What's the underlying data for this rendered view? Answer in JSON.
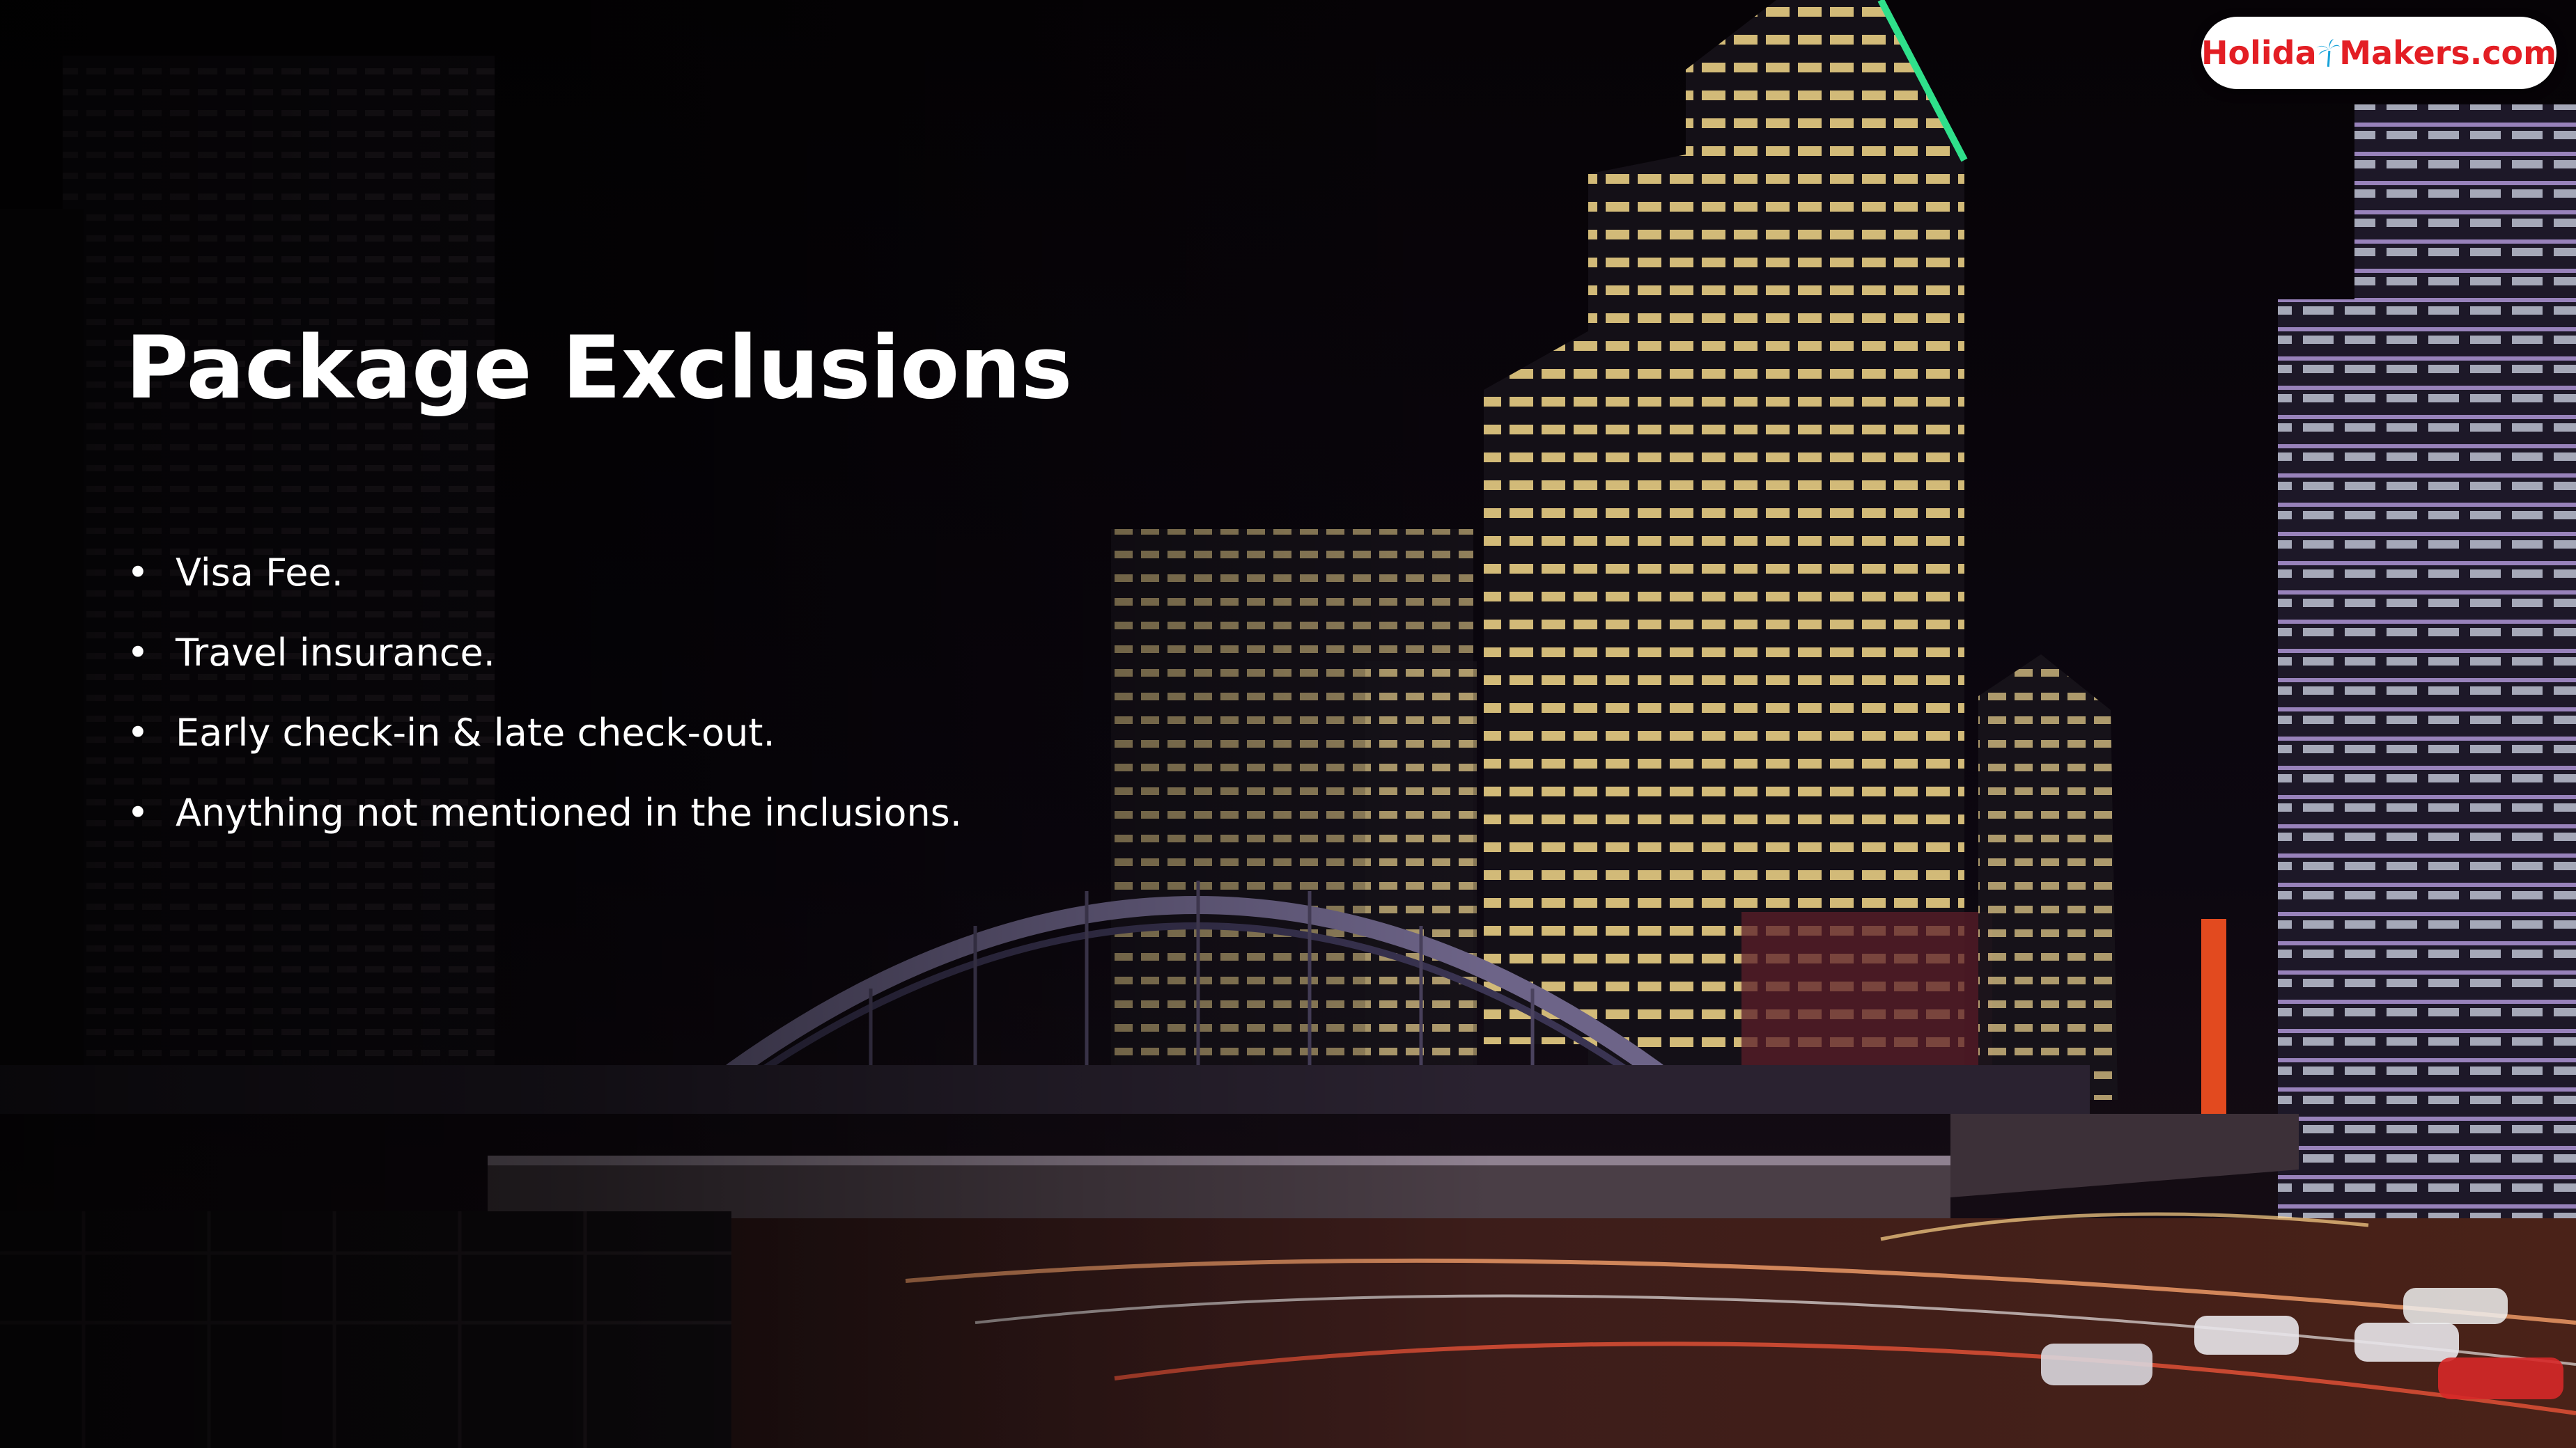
{
  "slide": {
    "title": "Package Exclusions",
    "bullet_glyph": "•",
    "bullets": [
      "Visa Fee.",
      "Travel insurance.",
      "Early check-in & late check-out.",
      "Anything not mentioned in the inclusions."
    ]
  },
  "logo": {
    "text_before_icon": "Holida",
    "text_after_icon": "Makers.com",
    "icon": "palm-tree-icon",
    "brand_color": "#e31e24",
    "icon_color": "#1aa3d9"
  },
  "colors": {
    "text": "#ffffff",
    "background": "#050305"
  }
}
